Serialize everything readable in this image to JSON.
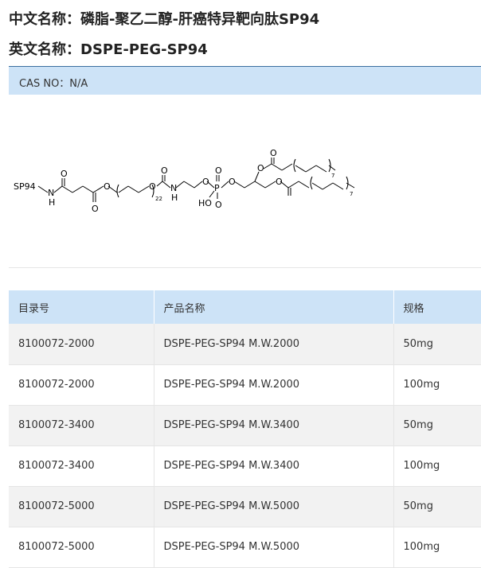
{
  "header": {
    "cn_label": "中文名称：",
    "cn_name": "磷脂-聚乙二醇-肝癌特异靶向肽SP94",
    "en_label": "英文名称：",
    "en_name": "DSPE-PEG-SP94"
  },
  "cas": {
    "text": "CAS NO：N/A"
  },
  "structure": {
    "labels": {
      "sp94": "SP94",
      "n1": "N",
      "h1": "H",
      "o1": "O",
      "o2": "O",
      "o3": "O",
      "o4": "O",
      "sub22": "22",
      "o5": "O",
      "n2": "N",
      "h2": "H",
      "o6": "O",
      "p": "P",
      "o7": "O",
      "ho": "HO",
      "o8": "O",
      "o9": "O",
      "o10": "O",
      "o11": "O",
      "o12": "O",
      "sub7a": "7",
      "sub7b": "7"
    }
  },
  "table": {
    "headers": [
      "目录号",
      "产品名称",
      "规格"
    ],
    "rows": [
      {
        "id": "8100072-2000",
        "name": "DSPE-PEG-SP94 M.W.2000",
        "spec": "50mg"
      },
      {
        "id": "8100072-2000",
        "name": "DSPE-PEG-SP94 M.W.2000",
        "spec": "100mg"
      },
      {
        "id": "8100072-3400",
        "name": "DSPE-PEG-SP94 M.W.3400",
        "spec": "50mg"
      },
      {
        "id": "8100072-3400",
        "name": "DSPE-PEG-SP94 M.W.3400",
        "spec": "100mg"
      },
      {
        "id": "8100072-5000",
        "name": "DSPE-PEG-SP94 M.W.5000",
        "spec": "50mg"
      },
      {
        "id": "8100072-5000",
        "name": "DSPE-PEG-SP94 M.W.5000",
        "spec": "100mg"
      }
    ]
  }
}
